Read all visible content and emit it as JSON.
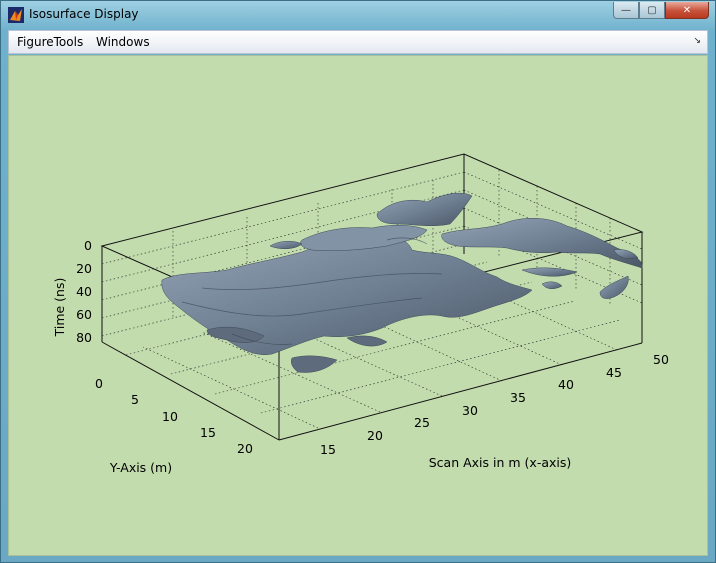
{
  "window": {
    "title": "Isosurface Display"
  },
  "titlebar": {
    "minimize": "—",
    "maximize": "▢",
    "close": "✕"
  },
  "menu": {
    "items": [
      "FigureTools",
      "Windows"
    ],
    "dock_arrow": "↘"
  },
  "plot": {
    "x_label": "Scan Axis in m (x-axis)",
    "y_label": "Y-Axis (m)",
    "z_label": "Time (ns)",
    "x_ticks": [
      "15",
      "20",
      "25",
      "30",
      "35",
      "40",
      "45",
      "50"
    ],
    "y_ticks": [
      "0",
      "5",
      "10",
      "15",
      "20"
    ],
    "z_ticks": [
      "0",
      "20",
      "40",
      "60",
      "80"
    ]
  },
  "colors": {
    "figure_bg": "#c3dcae",
    "surface": "#7a8a9c",
    "surface_dark": "#4c5868"
  }
}
